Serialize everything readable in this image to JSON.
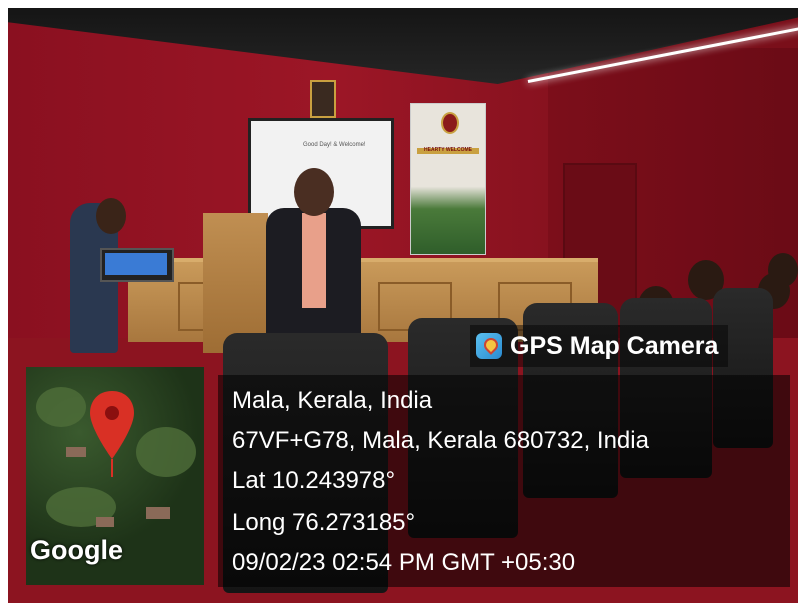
{
  "banner_text": "HEARTY WELCOME",
  "screen_text": "Good Day! & Welcome!",
  "overlay": {
    "app_name": "GPS Map Camera",
    "app_icon": "gps-map-camera-icon",
    "place": "Mala, Kerala, India",
    "address": "67VF+G78, Mala, Kerala 680732, India",
    "latitude": "Lat 10.243978°",
    "longitude": "Long 76.273185°",
    "datetime": "09/02/23 02:54 PM GMT +05:30"
  },
  "map": {
    "provider_label": "Google",
    "pin_icon": "map-pin-icon",
    "pin_color": "#d93025"
  }
}
